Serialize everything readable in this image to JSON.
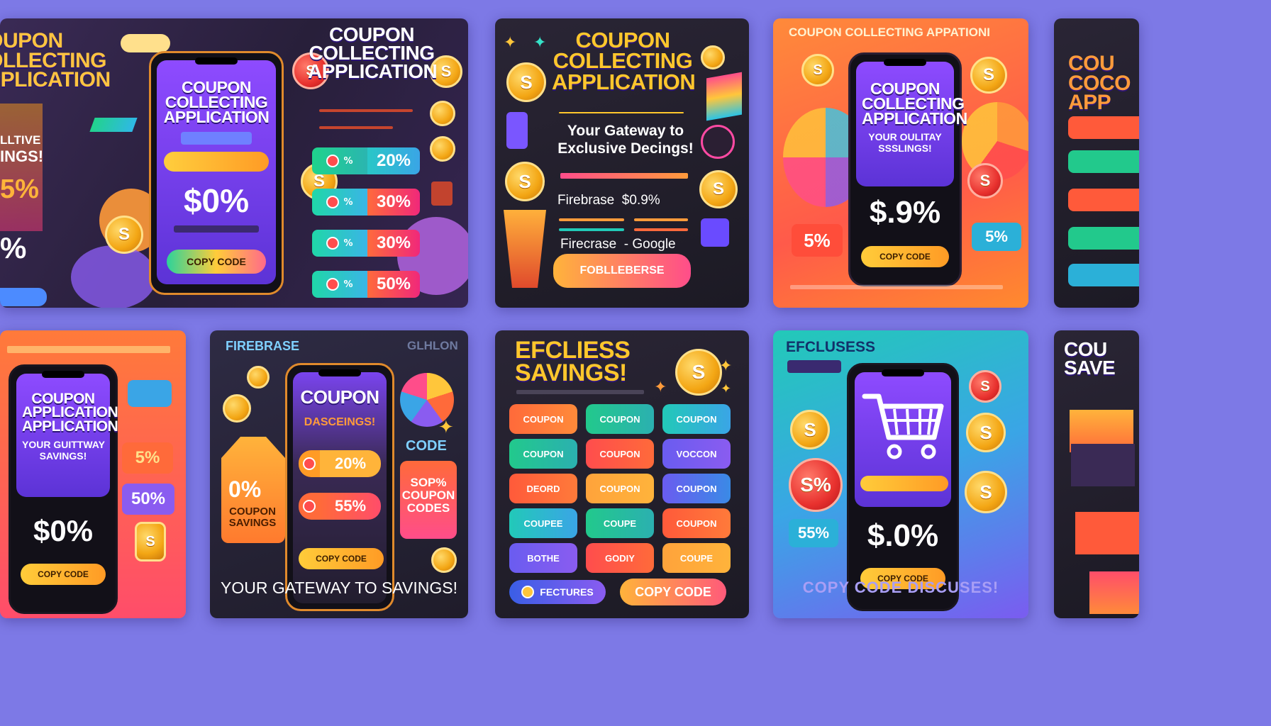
{
  "cards": {
    "c1": {
      "side_title": "COUPON\nCOLLECTING\nAPPLICATION",
      "title": "COUPON\nCOLLECTING\nAPPLICATION",
      "phone_title": "COUPON\nCOLLECTING\nAPPLICATION",
      "phone_value": "$0%",
      "phone_button": "COPY CODE",
      "side_left": [
        "LLTIVE",
        "INGS!",
        "5%",
        "%"
      ],
      "discounts": [
        "20%",
        "30%",
        "30%",
        "50%"
      ],
      "coin_symbol": "S"
    },
    "c2": {
      "title": "COUPON\nCOLLECTING\nAPPLICATION",
      "subtitle": "Your Gateway to\nExclusive Decings!",
      "row1": "Firebrase  $0.9%",
      "row2": "Firecrase  - Google",
      "button": "FOBLLEBERSE",
      "coin_symbol": "S"
    },
    "c3": {
      "header": "COUPON COLLECTING APPATIONI",
      "phone_title": "COUPON\nCOLLECTING\nAPPLICATION",
      "phone_subtitle": "YOUR OULITAY\nSSSLINGS!",
      "phone_value": "$.9%",
      "phone_button": "COPY CODE",
      "left_pct": "5%",
      "right_pct": "5%"
    },
    "c4": {
      "title": "COU\nCOCO\nAPP"
    },
    "c5": {
      "phone_title": "COUPON\nAPPLICATION\nAPPLICATION",
      "phone_subtitle": "YOUR GUITTWAY\nSAVINGS!",
      "phone_value": "$0%",
      "phone_button": "COPY CODE",
      "right_1": "5%",
      "right_2": "50%"
    },
    "c6": {
      "header_left": "FIREBRASE",
      "header_right": "GLHLON",
      "phone_title": "COUPON",
      "phone_subtitle": "DASCEINGS!",
      "disc_1": "20%",
      "disc_2": "55%",
      "phone_button": "COPY CODE",
      "tag_pct": "0%",
      "tag_text": "COUPON\nSAVINGS",
      "code_label": "CODE",
      "right_box": "SOP%\nCOUPON\nCODES",
      "footer": "YOUR GATEWAY TO SAVINGS!"
    },
    "c7": {
      "title": "EFCLIESS\nSAVINGS!",
      "chips": [
        "COUPON",
        "COUPON",
        "COUPON",
        "COUPON",
        "COUPON",
        "VOCCON",
        "DEORD",
        "COUPON",
        "COUPON",
        "COUPEE",
        "COUPE",
        "COUPON",
        "BOTHE",
        "GODIY",
        "COUPE"
      ],
      "features": "FECTURES",
      "copy_code": "COPY CODE"
    },
    "c8": {
      "title": "EFCLUSESS",
      "phone_value": "$.0%",
      "phone_button": "COPY CODE",
      "left_big": "S%",
      "left_pct": "55%",
      "footer": "COPY CODE DISCUSES!"
    },
    "c9": {
      "title": "COU\nSAVE"
    }
  },
  "colors": {
    "background": "#7d79e6",
    "dark_card": "#1f1c27",
    "orange": "#f36a2e",
    "purple": "#7a44ef",
    "gold": "#f5b51c",
    "teal": "#22c9b8"
  }
}
